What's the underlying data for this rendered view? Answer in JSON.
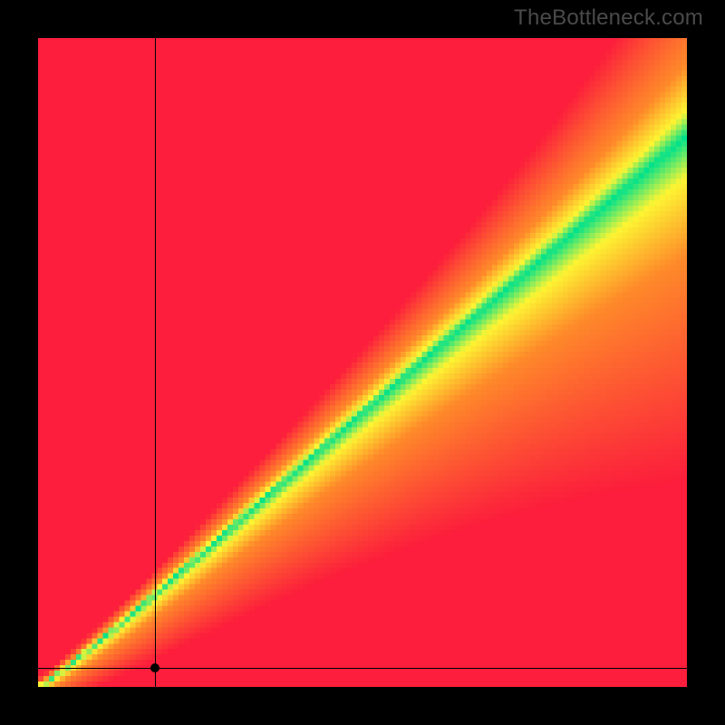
{
  "watermark": "TheBottleneck.com",
  "chart_data": {
    "type": "heatmap",
    "title": "",
    "xlabel": "",
    "ylabel": "",
    "xlim": [
      0,
      100
    ],
    "ylim": [
      0,
      100
    ],
    "grid": false,
    "legend_position": "none",
    "annotations": [],
    "optimal_band_endpoints": {
      "x_start": 0,
      "y_start": 0,
      "x_end": 100,
      "y_end_low": 75,
      "y_end_high": 95
    },
    "crosshair": {
      "x": 18,
      "y": 3
    },
    "marker": {
      "x": 18,
      "y": 3
    },
    "color_stops": {
      "red": "#fc1e3c",
      "orange": "#ff8a2a",
      "yellow": "#fdf533",
      "green": "#00e28c"
    },
    "pixelated": true,
    "resolution": 120
  }
}
